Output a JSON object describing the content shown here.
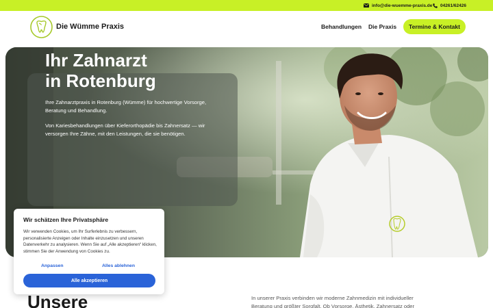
{
  "topbar": {
    "email": "info@die-wuemme-praxis.de",
    "phone": "04261/62426",
    "email_icon": "envelope-icon",
    "phone_icon": "phone-icon"
  },
  "header": {
    "logo_text": "Die Wümme Praxis",
    "nav": {
      "treatments": "Behandlungen",
      "practice": "Die Praxis",
      "cta": "Termine & Kontakt"
    }
  },
  "hero": {
    "title_line1": "Ihr Zahnarzt",
    "title_line2": "in Rotenburg",
    "paragraph1": "Ihre Zahnarztpraxis in Rotenburg (Wümme) für hochwertige Vorsorge, Beratung und Behandlung.",
    "paragraph2": "Von Kariesbehandlungen über Kieferorthopädie bis Zahnersatz — wir versorgen Ihre Zähne, mit den Leistungen, die sie benötigen."
  },
  "cookie": {
    "title": "Wir schätzen Ihre Privatsphäre",
    "text": "Wir verwenden Cookies, um Ihr Surferlebnis zu verbessern, personalisierte Anzeigen oder Inhalte einzusetzen und unseren Datenverkehr zu analysieren. Wenn Sie auf „Alle akzeptieren“ klicken, stimmen Sie der Anwendung von Cookies zu.",
    "adjust": "Anpassen",
    "reject": "Alles ablehnen",
    "accept": "Alle akzeptieren"
  },
  "section": {
    "heading": "Unsere",
    "text": "In unserer Praxis verbinden wir moderne Zahnmedizin mit individueller Beratung und größter Sorgfalt. Ob Vorsorge, Ästhetik, Zahnersatz oder"
  },
  "colors": {
    "accent": "#c8f026",
    "link_blue": "#2a63d8",
    "text_dark": "#1a1a1a"
  }
}
